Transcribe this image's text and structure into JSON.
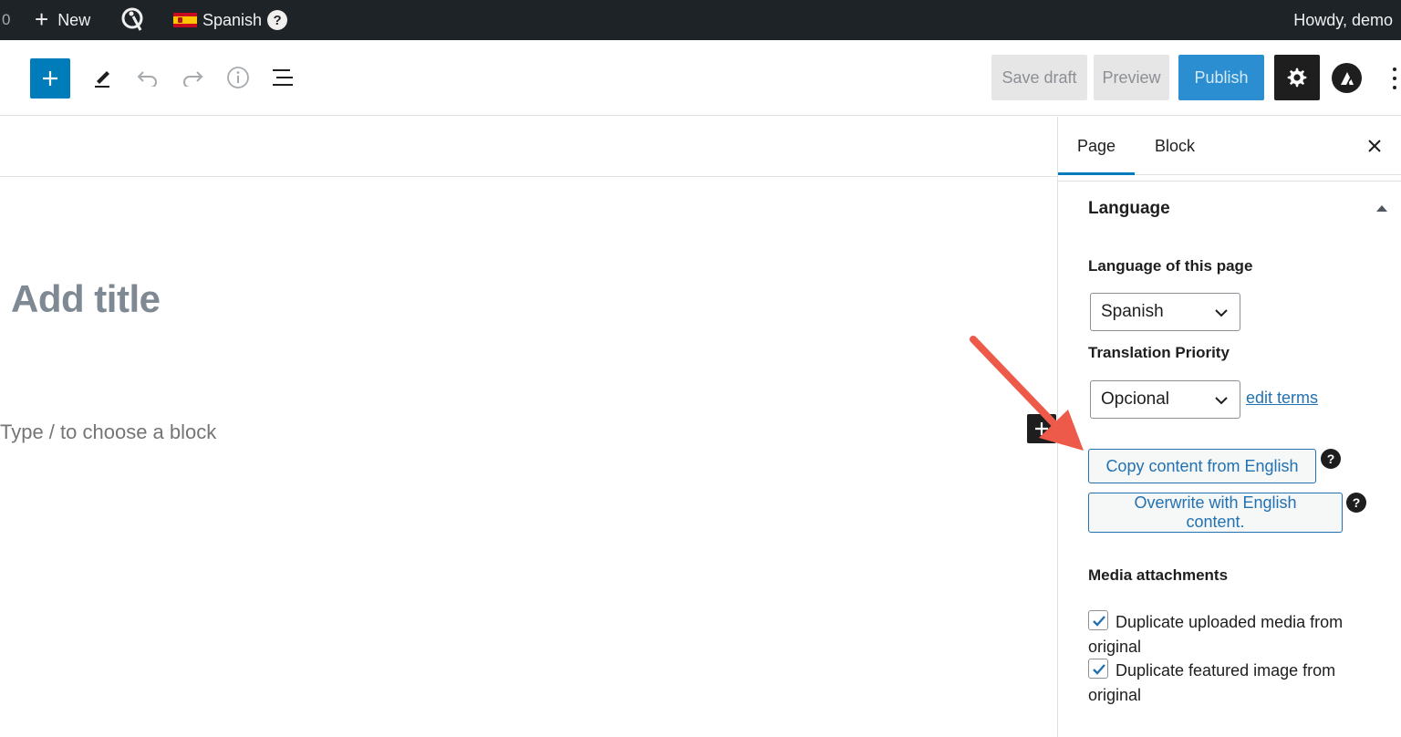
{
  "admin_bar": {
    "count": "0",
    "new_label": "New",
    "language_label": "Spanish",
    "help_glyph": "?",
    "howdy": "Howdy, demo"
  },
  "toolbar": {
    "save_draft": "Save draft",
    "preview": "Preview",
    "publish": "Publish"
  },
  "editor": {
    "title_placeholder": "Add title",
    "block_placeholder": "Type / to choose a block"
  },
  "sidebar": {
    "tabs": [
      {
        "label": "Page",
        "active": true
      },
      {
        "label": "Block",
        "active": false
      }
    ],
    "panel_title": "Language",
    "language_label": "Language of this page",
    "language_value": "Spanish",
    "priority_label": "Translation Priority",
    "priority_value": "Opcional",
    "edit_terms": "edit terms",
    "copy_button": "Copy content from English",
    "overwrite_button": "Overwrite with English content.",
    "help_glyph": "?",
    "media_label": "Media attachments",
    "checkboxes": [
      {
        "label": "Duplicate uploaded media from original",
        "checked": true
      },
      {
        "label": "Duplicate featured image from original",
        "checked": true
      }
    ]
  },
  "colors": {
    "admin_bar": "#1d2327",
    "accent": "#007cba",
    "link": "#2271b1",
    "annotation_arrow": "#ee5a4a"
  },
  "icons": [
    "plus-icon",
    "query-monitor-icon",
    "spain-flag-icon",
    "pen-icon",
    "undo-icon",
    "redo-icon",
    "info-icon",
    "list-view-icon",
    "gear-icon",
    "astra-icon",
    "kebab-icon",
    "close-icon",
    "chevron-down-icon",
    "checkmark-icon"
  ]
}
